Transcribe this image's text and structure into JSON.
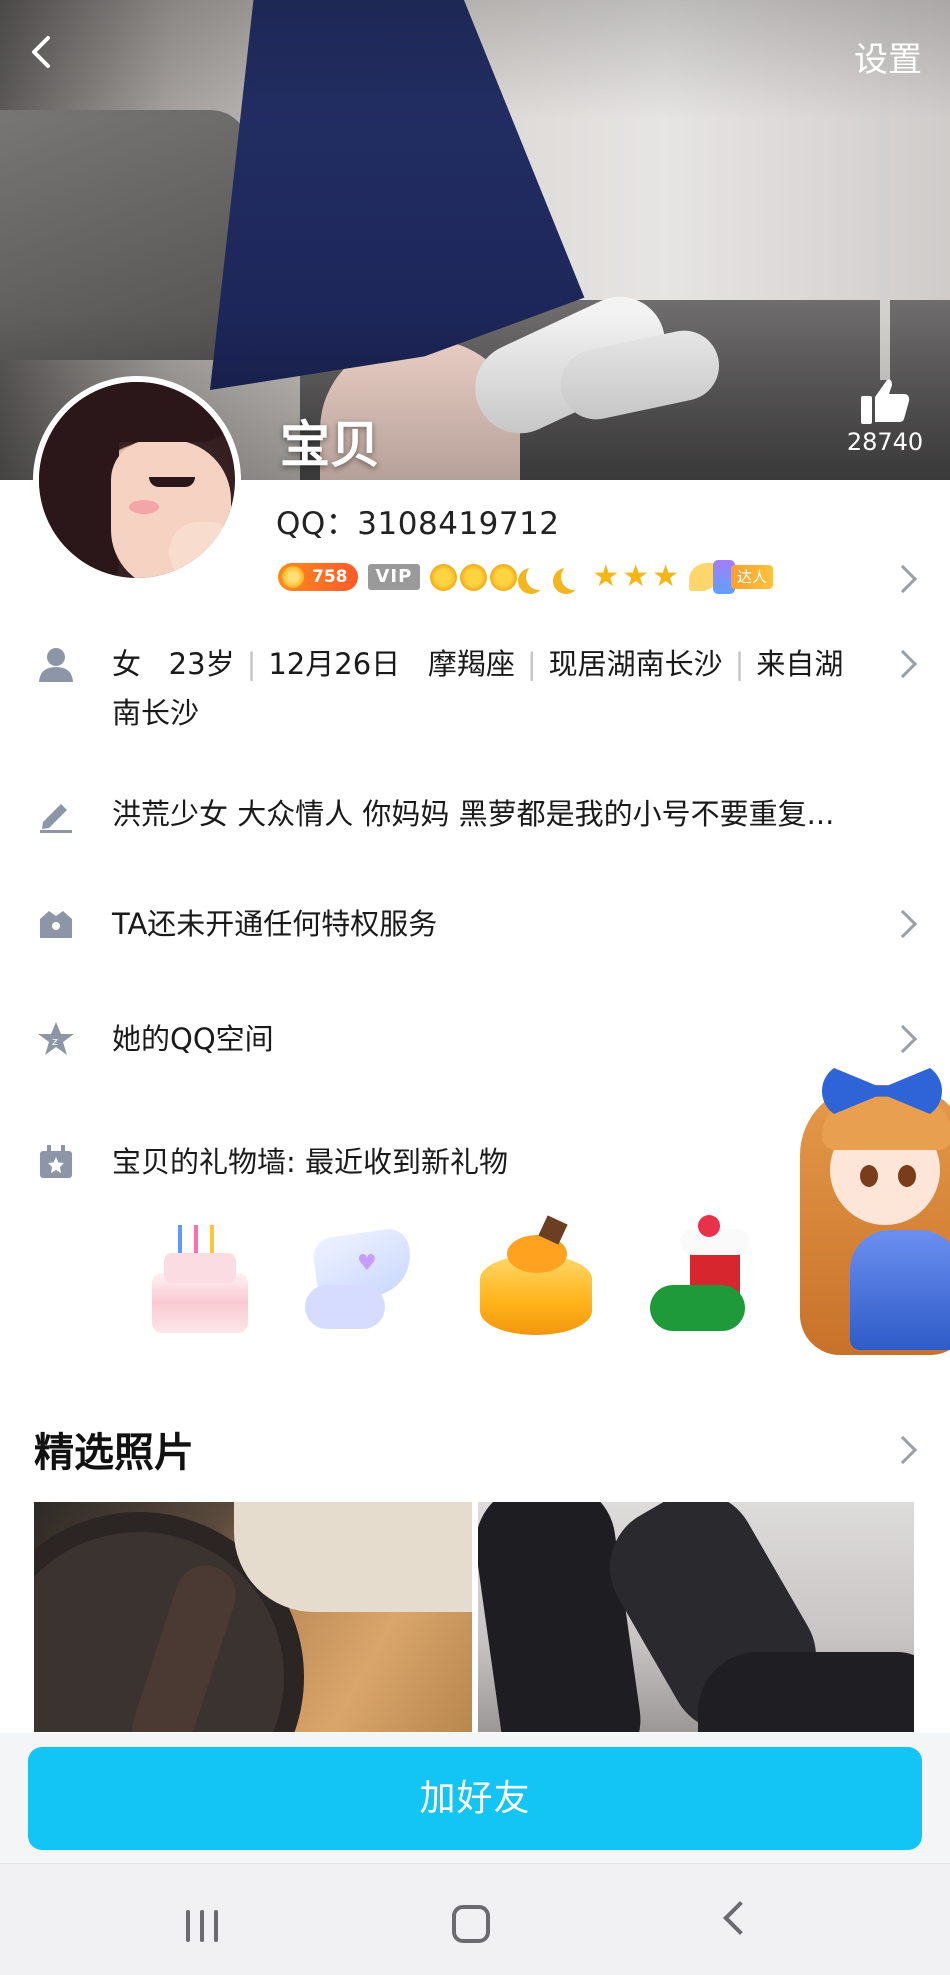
{
  "header": {
    "settings_label": "设置"
  },
  "profile": {
    "name": "宝贝",
    "qq": "QQ：3108419712",
    "likes": "28740",
    "coins": "758",
    "vip_label": "VIP",
    "talent_label": "达人"
  },
  "info": {
    "gender": "女",
    "age": "23岁",
    "birthday": "12月26日",
    "zodiac": "摩羯座",
    "residence": "现居湖南长沙",
    "hometown_line1": "来自湖",
    "hometown_line2": "南长沙",
    "signature": "洪荒少女 大众情人 你妈妈 黑萝都是我的小号不要重复...",
    "privilege": "TA还未开通任何特权服务",
    "qzone": "她的QQ空间",
    "gift_wall": "宝贝的礼物墙: 最近收到新礼物"
  },
  "gifts": [
    "birthday-cake",
    "sock",
    "mango-cake",
    "christmas-boot"
  ],
  "photos": {
    "section_title": "精选照片"
  },
  "actions": {
    "add_friend_label": "加好友"
  },
  "colors": {
    "accent": "#12c5f5",
    "chevron": "#9aa0a6",
    "icon": "#8d96a6"
  },
  "icons": [
    "back-icon",
    "thumbs-up-icon",
    "person-icon",
    "pencil-icon",
    "crown-icon",
    "star-icon",
    "gift-icon",
    "chevron-right-icon"
  ]
}
